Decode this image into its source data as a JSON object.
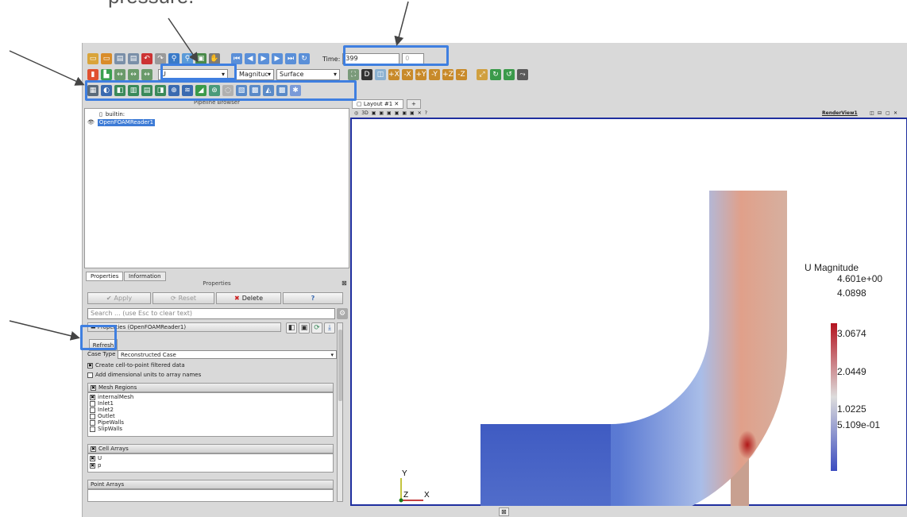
{
  "caption": {
    "text": "pressure."
  },
  "toolbar": {
    "time_label": "Time:",
    "time_value": "399",
    "time_index": "0",
    "variable_value": "U",
    "component_value": "Magnitude",
    "representation_value": "Surface"
  },
  "pipeline": {
    "title": "Pipeline Browser",
    "items": [
      {
        "label": "builtin:"
      },
      {
        "label": "OpenFOAMReader1"
      }
    ]
  },
  "properties_panel": {
    "tabs": [
      {
        "label": "Properties"
      },
      {
        "label": "Information"
      }
    ],
    "title": "Properties",
    "apply_label": "Apply",
    "reset_label": "Reset",
    "delete_label": "Delete",
    "help_label": "?",
    "search_placeholder": "Search ... (use Esc to clear text)",
    "group_label": "Properties (OpenFOAMReader1)",
    "refresh_label": "Refresh",
    "case_type_label": "Case Type",
    "case_type_value": "Reconstructed Case",
    "options": [
      {
        "label": "Create cell-to-point filtered data",
        "checked": true
      },
      {
        "label": "Add dimensional units to array names",
        "checked": false
      }
    ],
    "mesh_regions_label": "Mesh Regions",
    "mesh_regions": [
      {
        "label": "internalMesh",
        "checked": true
      },
      {
        "label": "Inlet1",
        "checked": false
      },
      {
        "label": "Inlet2",
        "checked": false
      },
      {
        "label": "Outlet",
        "checked": false
      },
      {
        "label": "PipeWalls",
        "checked": false
      },
      {
        "label": "SlipWalls",
        "checked": false
      }
    ],
    "cell_arrays_label": "Cell Arrays",
    "cell_arrays": [
      {
        "label": "U",
        "checked": true
      },
      {
        "label": "p",
        "checked": true
      }
    ],
    "point_arrays_label": "Point Arrays"
  },
  "view": {
    "tab_label": "Layout #1",
    "tab_add": "+",
    "view_name": "RenderView1",
    "toolbar_3d": "3D",
    "axis_y": "Y",
    "axis_z": "Z",
    "axis_x": "X"
  },
  "legend": {
    "title": "U Magnitude",
    "ticks": [
      "4.601e+00",
      "4.0898",
      "3.0674",
      "2.0449",
      "1.0225",
      "5.109e-01"
    ],
    "colors": {
      "top": "#b4131f",
      "mid": "#dddcdc",
      "bottom": "#3b4cc0"
    }
  }
}
